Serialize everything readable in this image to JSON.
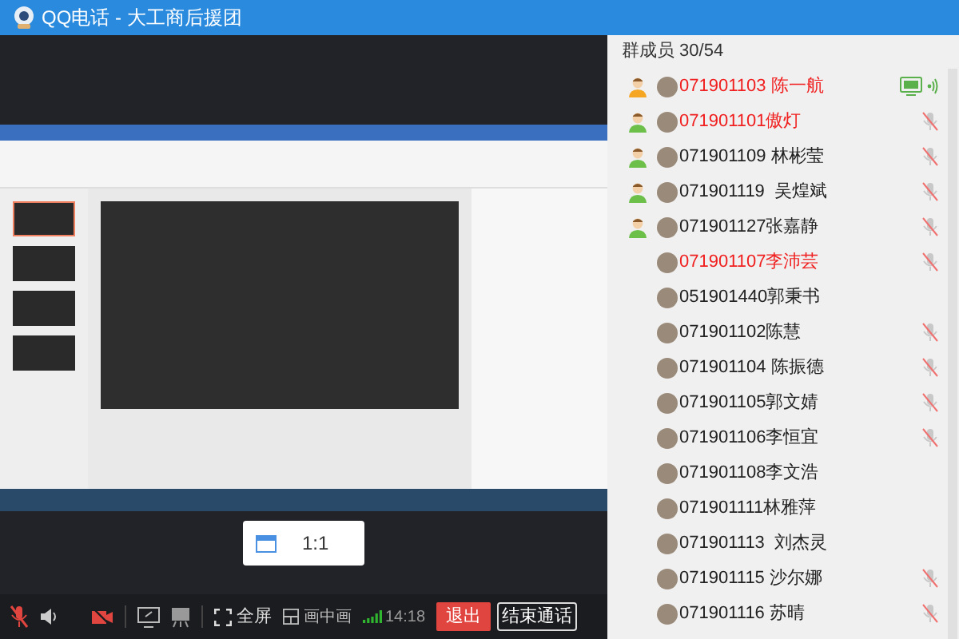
{
  "window": {
    "title": "QQ电话 - 大工商后援团"
  },
  "zoom_popup": {
    "label": "1:1"
  },
  "toolbar": {
    "mic_muted": true,
    "camera_off": true,
    "fullscreen_label": "全屏",
    "pip_label": "画中画",
    "time": "14:18",
    "exit_label": "退出",
    "end_label": "结束通话"
  },
  "members_panel": {
    "header": "群成员 30/54",
    "members": [
      {
        "name": "071901103 陈一航",
        "owner": true,
        "admin": false,
        "highlighted": true,
        "muted": false,
        "speaking": true,
        "sharing": true
      },
      {
        "name": "071901101傲灯",
        "owner": false,
        "admin": true,
        "highlighted": true,
        "muted": true,
        "speaking": false,
        "sharing": false
      },
      {
        "name": "071901109 林彬莹",
        "owner": false,
        "admin": true,
        "highlighted": false,
        "muted": true,
        "speaking": false,
        "sharing": false
      },
      {
        "name": "071901119  吴煌斌",
        "owner": false,
        "admin": true,
        "highlighted": false,
        "muted": true,
        "speaking": false,
        "sharing": false
      },
      {
        "name": "071901127张嘉静",
        "owner": false,
        "admin": true,
        "highlighted": false,
        "muted": true,
        "speaking": false,
        "sharing": false
      },
      {
        "name": "071901107李沛芸",
        "owner": false,
        "admin": false,
        "highlighted": true,
        "muted": true,
        "speaking": false,
        "sharing": false
      },
      {
        "name": "051901440郭秉书",
        "owner": false,
        "admin": false,
        "highlighted": false,
        "muted": false,
        "speaking": false,
        "sharing": false
      },
      {
        "name": "071901102陈慧",
        "owner": false,
        "admin": false,
        "highlighted": false,
        "muted": true,
        "speaking": false,
        "sharing": false
      },
      {
        "name": "071901104 陈振德",
        "owner": false,
        "admin": false,
        "highlighted": false,
        "muted": true,
        "speaking": false,
        "sharing": false
      },
      {
        "name": "071901105郭文婧",
        "owner": false,
        "admin": false,
        "highlighted": false,
        "muted": true,
        "speaking": false,
        "sharing": false
      },
      {
        "name": "071901106李恒宜",
        "owner": false,
        "admin": false,
        "highlighted": false,
        "muted": true,
        "speaking": false,
        "sharing": false
      },
      {
        "name": "071901108李文浩",
        "owner": false,
        "admin": false,
        "highlighted": false,
        "muted": false,
        "speaking": false,
        "sharing": false
      },
      {
        "name": "071901111林雅萍",
        "owner": false,
        "admin": false,
        "highlighted": false,
        "muted": false,
        "speaking": false,
        "sharing": false
      },
      {
        "name": "071901113  刘杰灵",
        "owner": false,
        "admin": false,
        "highlighted": false,
        "muted": false,
        "speaking": false,
        "sharing": false
      },
      {
        "name": "071901115 沙尔娜",
        "owner": false,
        "admin": false,
        "highlighted": false,
        "muted": true,
        "speaking": false,
        "sharing": false
      },
      {
        "name": "071901116 苏晴",
        "owner": false,
        "admin": false,
        "highlighted": false,
        "muted": true,
        "speaking": false,
        "sharing": false
      }
    ]
  }
}
